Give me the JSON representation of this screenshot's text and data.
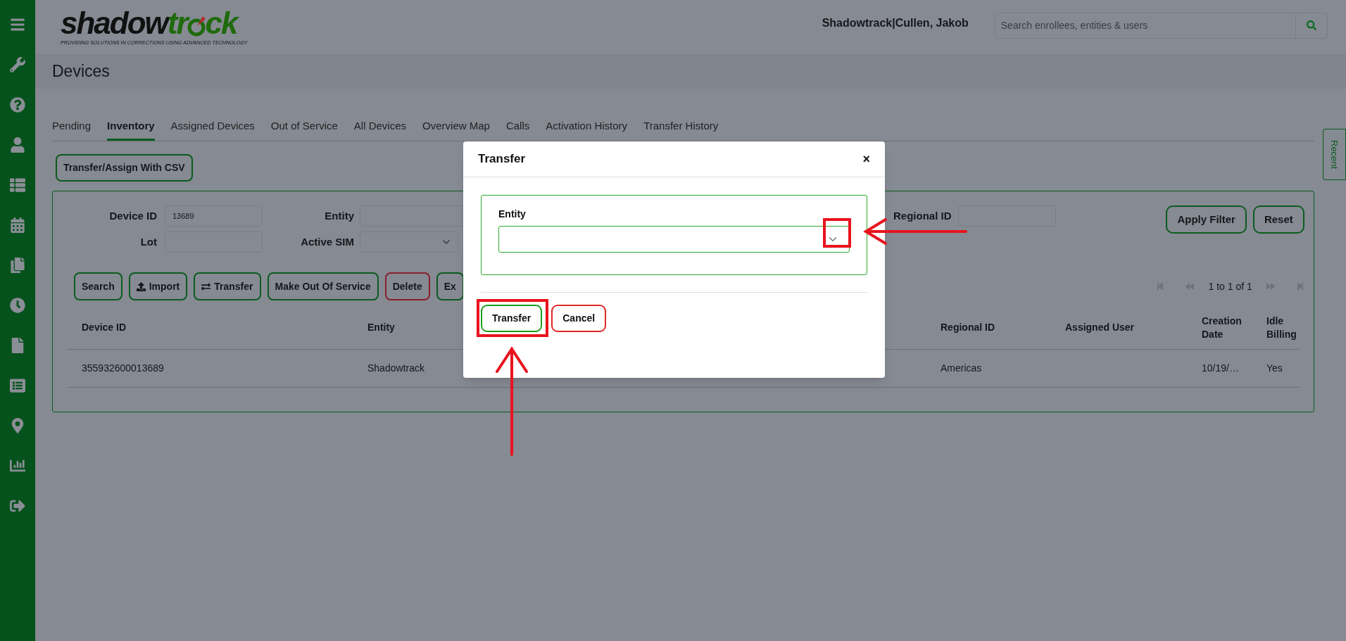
{
  "header": {
    "logo": {
      "part_1": "shadow",
      "part_2": "tr",
      "part_3": "ck",
      "tagline": "PROVIDING SOLUTIONS IN CORRECTIONS USING ADVANCED TECHNOLOGY"
    },
    "user": "Shadowtrack|Cullen, Jakob",
    "search": {
      "placeholder": "Search enrollees, entities & users"
    }
  },
  "page_title": "Devices",
  "tabs": [
    {
      "label": "Pending",
      "selected": false
    },
    {
      "label": "Inventory",
      "selected": true
    },
    {
      "label": "Assigned Devices",
      "selected": false
    },
    {
      "label": "Out of Service",
      "selected": false
    },
    {
      "label": "All Devices",
      "selected": false
    },
    {
      "label": "Overview Map",
      "selected": false
    },
    {
      "label": "Calls",
      "selected": false
    },
    {
      "label": "Activation History",
      "selected": false
    },
    {
      "label": "Transfer History",
      "selected": false
    }
  ],
  "csv_button": "Transfer/Assign With CSV",
  "filters": {
    "device_id": {
      "label": "Device ID",
      "value": "13689"
    },
    "entity": {
      "label": "Entity"
    },
    "regional_id": {
      "label": "Regional ID"
    },
    "lot": {
      "label": "Lot"
    },
    "active_sim": {
      "label": "Active SIM"
    }
  },
  "filter_buttons": [
    "Apply Filter",
    "Reset"
  ],
  "actions": [
    {
      "label": "Search",
      "kind": "plain"
    },
    {
      "label": "Import",
      "kind": "upload"
    },
    {
      "label": "Transfer",
      "kind": "swap"
    },
    {
      "label": "Make Out Of Service",
      "kind": "plain"
    },
    {
      "label": "Delete",
      "kind": "danger"
    },
    {
      "label": "Ex",
      "kind": "plain"
    }
  ],
  "pagination": {
    "text": "1 to 1 of 1",
    "controls": [
      {
        "kind": "first",
        "disabled": true
      },
      {
        "kind": "previous",
        "disabled": true
      },
      {
        "kind": "next",
        "disabled": true
      },
      {
        "kind": "last",
        "disabled": true
      }
    ]
  },
  "table": {
    "columns": [
      "Device ID",
      "Entity",
      "Regional ID",
      "Assigned User",
      "Creation Date",
      "Idle Billing"
    ],
    "rows": [
      {
        "device_id": "355932600013689",
        "entity": "Shadowtrack",
        "regional_id": "Americas",
        "creation_date": "10/19/…",
        "idle_billing": "Yes"
      }
    ]
  },
  "recent_tab": "Recent",
  "modal": {
    "title": "Transfer",
    "close": "×",
    "field_label": "Entity",
    "buttons": [
      {
        "label": "Transfer",
        "kind": "primary"
      },
      {
        "label": "Cancel",
        "kind": "cancel"
      }
    ]
  }
}
